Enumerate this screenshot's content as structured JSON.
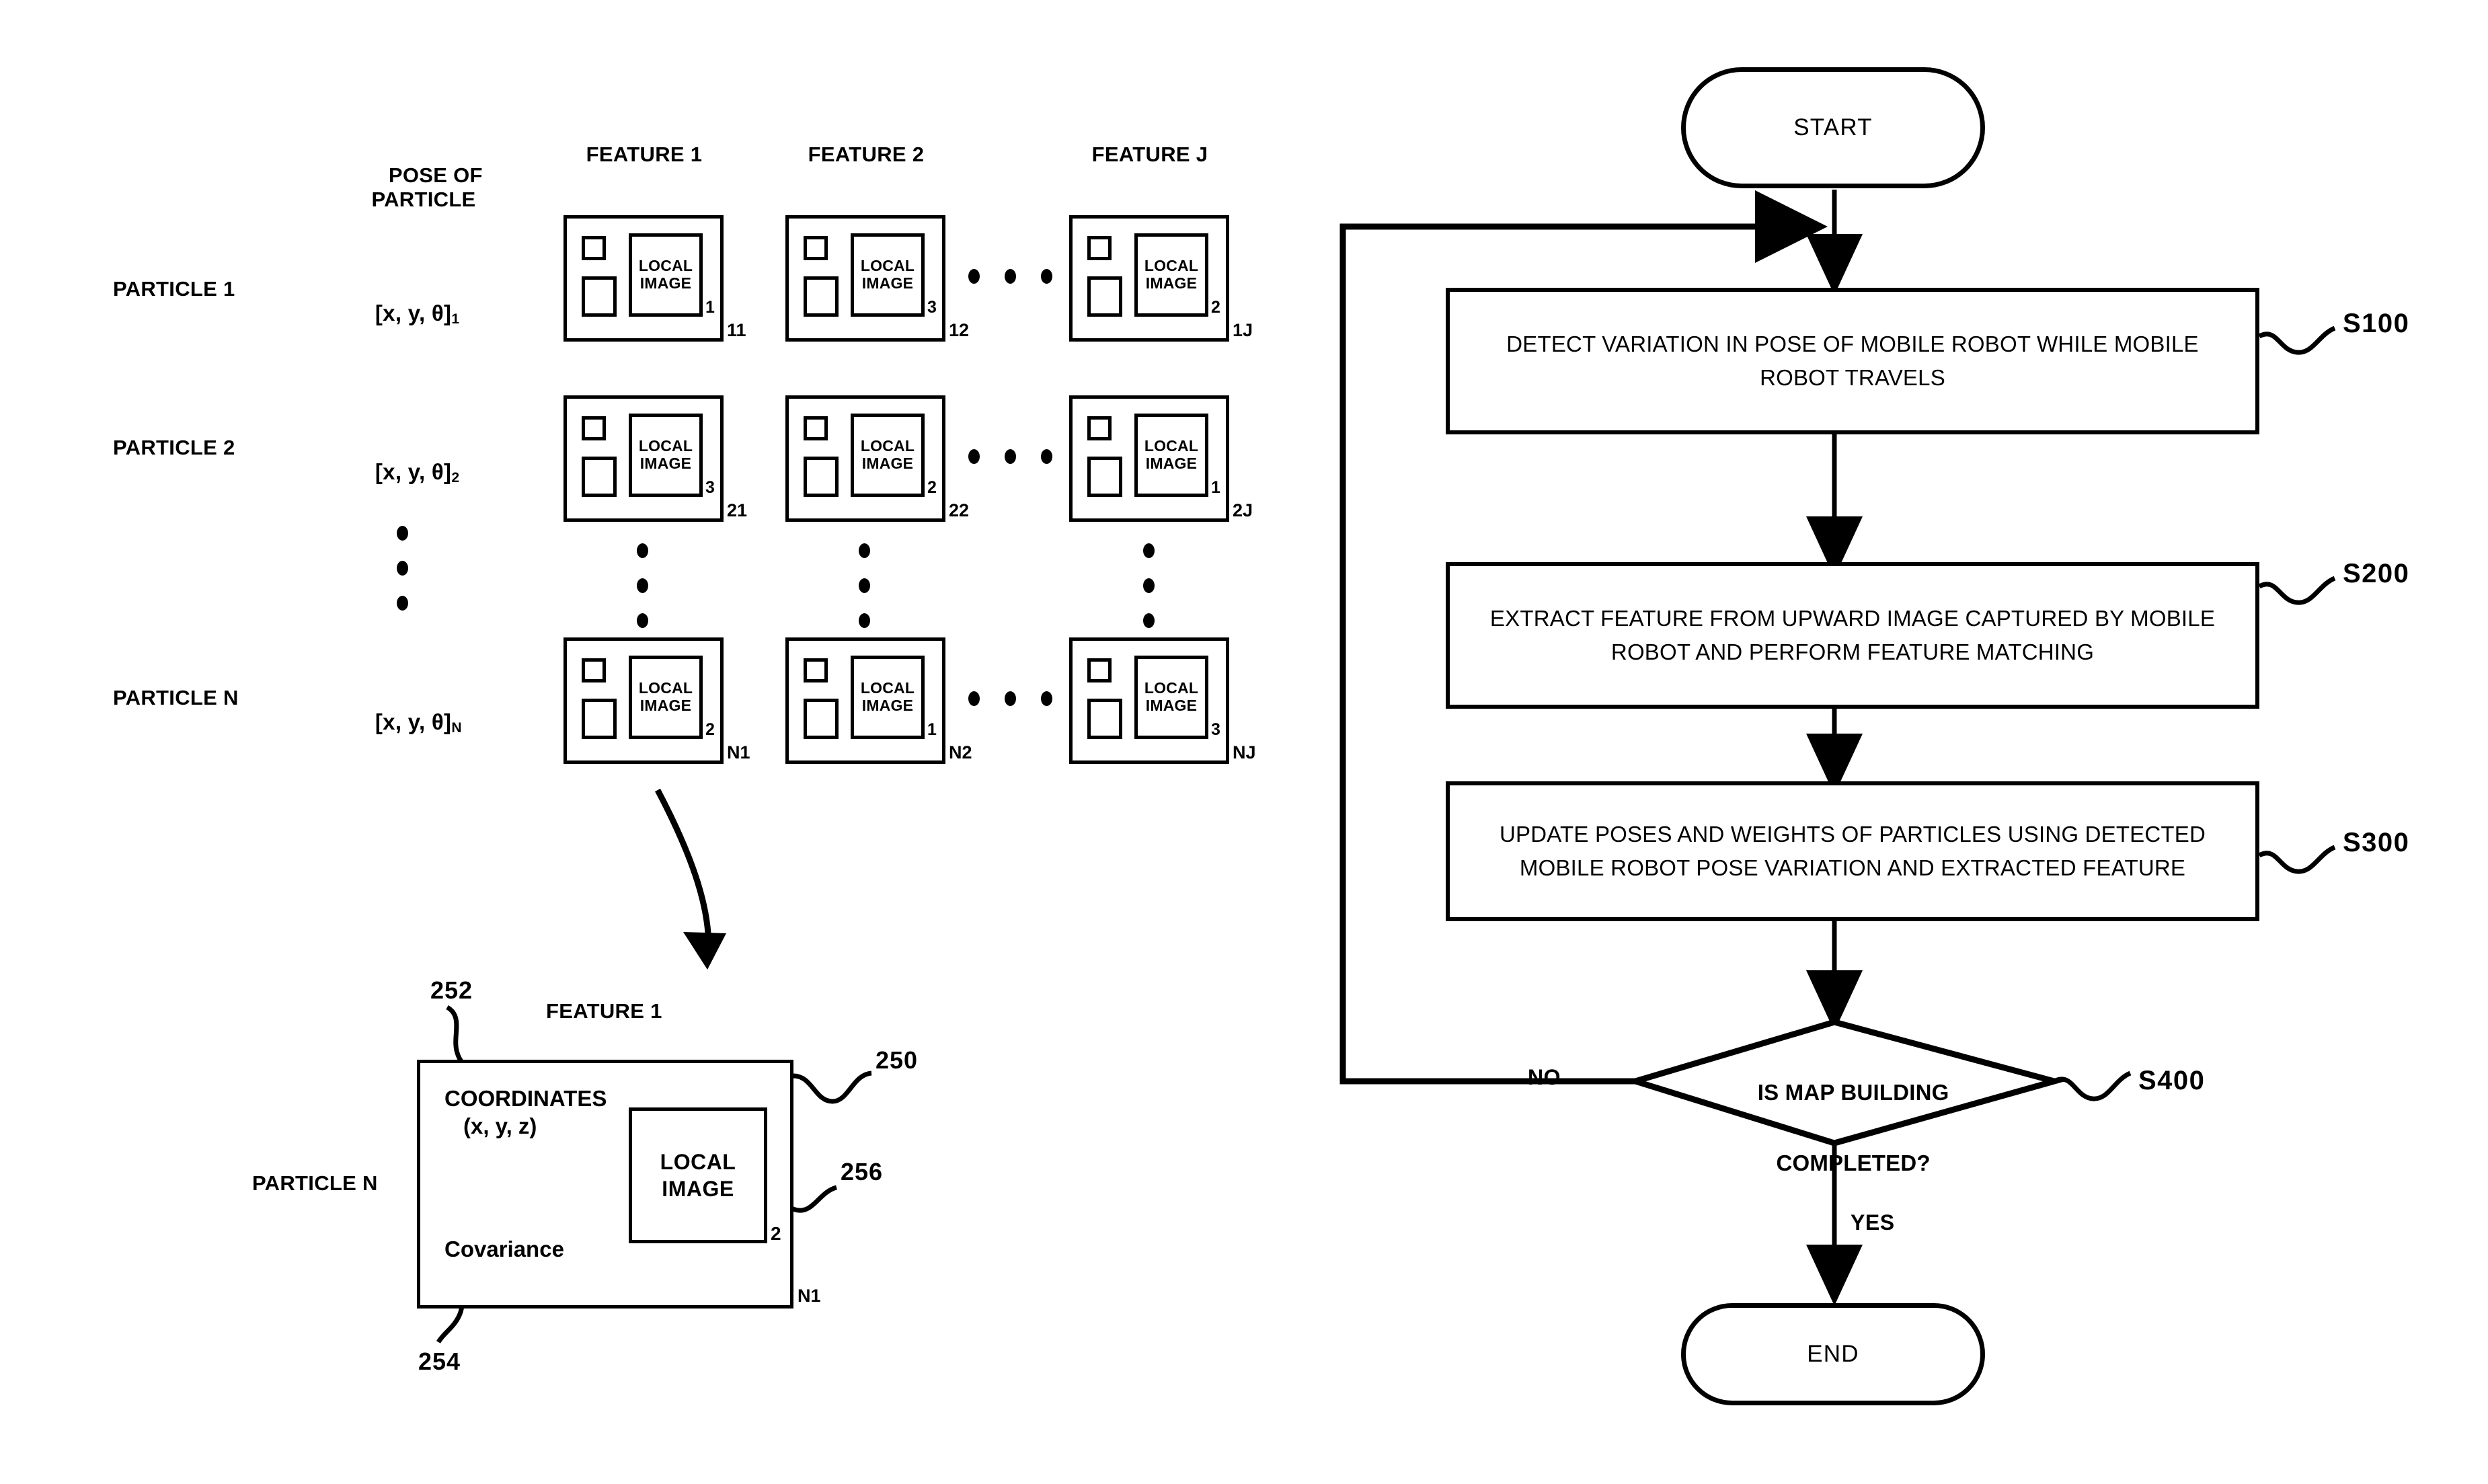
{
  "left_diagram": {
    "column_headers": {
      "pose": "POSE OF\nPARTICLE",
      "features": [
        "FEATURE 1",
        "FEATURE 2",
        "FEATURE J"
      ]
    },
    "rows": [
      {
        "particle_label": "PARTICLE 1",
        "pose_base": "[x, y, θ]",
        "pose_sub": "1",
        "cells": [
          {
            "local_image_line1": "LOCAL",
            "local_image_line2": "IMAGE",
            "inner_sub": "1",
            "outer_sub": "11"
          },
          {
            "local_image_line1": "LOCAL",
            "local_image_line2": "IMAGE",
            "inner_sub": "3",
            "outer_sub": "12"
          },
          {
            "local_image_line1": "LOCAL",
            "local_image_line2": "IMAGE",
            "inner_sub": "2",
            "outer_sub": "1J"
          }
        ]
      },
      {
        "particle_label": "PARTICLE 2",
        "pose_base": "[x, y, θ]",
        "pose_sub": "2",
        "cells": [
          {
            "local_image_line1": "LOCAL",
            "local_image_line2": "IMAGE",
            "inner_sub": "3",
            "outer_sub": "21"
          },
          {
            "local_image_line1": "LOCAL",
            "local_image_line2": "IMAGE",
            "inner_sub": "2",
            "outer_sub": "22"
          },
          {
            "local_image_line1": "LOCAL",
            "local_image_line2": "IMAGE",
            "inner_sub": "1",
            "outer_sub": "2J"
          }
        ]
      },
      {
        "particle_label": "PARTICLE N",
        "pose_base": "[x, y, θ]",
        "pose_sub": "N",
        "cells": [
          {
            "local_image_line1": "LOCAL",
            "local_image_line2": "IMAGE",
            "inner_sub": "2",
            "outer_sub": "N1"
          },
          {
            "local_image_line1": "LOCAL",
            "local_image_line2": "IMAGE",
            "inner_sub": "1",
            "outer_sub": "N2"
          },
          {
            "local_image_line1": "LOCAL",
            "local_image_line2": "IMAGE",
            "inner_sub": "3",
            "outer_sub": "NJ"
          }
        ]
      }
    ],
    "detail": {
      "particle_label": "PARTICLE N",
      "feature_label": "FEATURE 1",
      "coordinates_line1": "COORDINATES",
      "coordinates_line2": "(x, y, z)",
      "covariance": "Covariance",
      "local_image_line1": "LOCAL",
      "local_image_line2": "IMAGE",
      "local_image_sub": "2",
      "box_sub": "N1",
      "ref_box": "250",
      "ref_coordinates": "252",
      "ref_covariance": "254",
      "ref_local_image": "256"
    }
  },
  "flowchart": {
    "start_label": "START",
    "end_label": "END",
    "steps": [
      {
        "text": "DETECT VARIATION IN POSE OF MOBILE ROBOT WHILE MOBILE ROBOT TRAVELS",
        "ref": "S100"
      },
      {
        "text": "EXTRACT FEATURE FROM UPWARD IMAGE CAPTURED BY MOBILE ROBOT AND PERFORM FEATURE MATCHING",
        "ref": "S200"
      },
      {
        "text": "UPDATE POSES AND WEIGHTS OF PARTICLES USING DETECTED MOBILE ROBOT POSE VARIATION AND EXTRACTED FEATURE",
        "ref": "S300"
      }
    ],
    "decision": {
      "line1": "IS MAP BUILDING",
      "line2": "COMPLETED?",
      "ref": "S400",
      "branch_no": "NO",
      "branch_yes": "YES"
    }
  },
  "colors": {
    "ink": "#000000",
    "paper": "#ffffff"
  }
}
